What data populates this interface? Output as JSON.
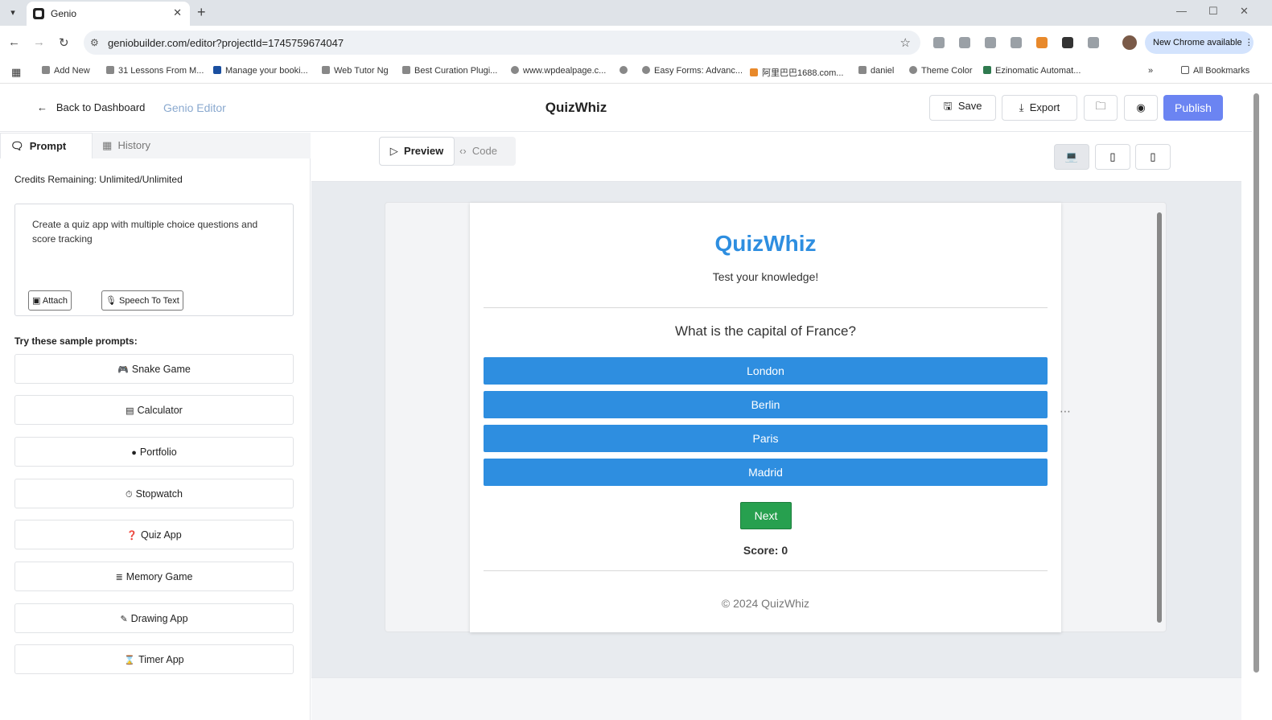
{
  "browser": {
    "tab_title": "Genio",
    "url": "geniobuilder.com/editor?projectId=1745759674047",
    "chrome_update": "New Chrome available",
    "bookmarks": [
      "Add New",
      "31 Lessons From M...",
      "Manage your booki...",
      "Web Tutor Ng",
      "Best Curation Plugi...",
      "www.wpdealpage.c...",
      "Easy Forms: Advanc...",
      "阿里巴巴1688.com...",
      "daniel",
      "Theme Color",
      "Ezinomatic Automat..."
    ],
    "all_bookmarks": "All Bookmarks"
  },
  "header": {
    "back_label": "Back to Dashboard",
    "brand": "Genio Editor",
    "project_title": "QuizWhiz",
    "save_label": "Save",
    "export_label": "Export",
    "publish_label": "Publish"
  },
  "left": {
    "tab_prompt": "Prompt",
    "tab_history": "History",
    "credits": "Credits Remaining: Unlimited/Unlimited",
    "prompt_text": "Create a quiz app with multiple choice questions and score tracking",
    "attach_label": "Attach",
    "speech_label": "Speech To Text",
    "samples_title": "Try these sample prompts:",
    "samples": [
      {
        "label": "Snake Game",
        "icon": "gamepad-icon"
      },
      {
        "label": "Calculator",
        "icon": "calculator-icon"
      },
      {
        "label": "Portfolio",
        "icon": "user-circle-icon"
      },
      {
        "label": "Stopwatch",
        "icon": "stopwatch-icon"
      },
      {
        "label": "Quiz App",
        "icon": "question-circle-icon"
      },
      {
        "label": "Memory Game",
        "icon": "layers-icon"
      },
      {
        "label": "Drawing App",
        "icon": "brush-icon"
      },
      {
        "label": "Timer App",
        "icon": "hourglass-icon"
      }
    ]
  },
  "right": {
    "preview_label": "Preview",
    "code_label": "Code"
  },
  "quiz": {
    "title": "QuizWhiz",
    "subtitle": "Test your knowledge!",
    "question": "What is the capital of France?",
    "options": [
      "London",
      "Berlin",
      "Paris",
      "Madrid"
    ],
    "next_label": "Next",
    "score": "Score: 0",
    "footer": "© 2024 QuizWhiz"
  },
  "colors": {
    "accent": "#2e8ee0",
    "publish": "#6b84f2",
    "next": "#27a04f"
  }
}
